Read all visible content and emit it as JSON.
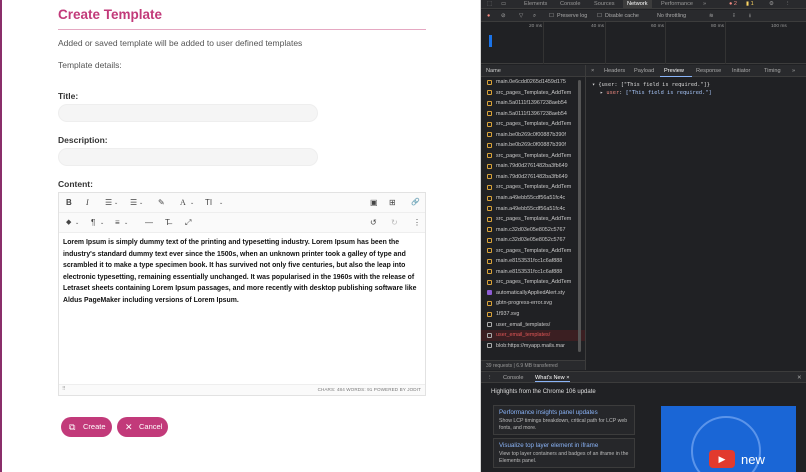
{
  "form": {
    "title": "Create Template",
    "subtitle": "Added or saved template will be added to user defined templates",
    "details_label": "Template details:",
    "title_label": "Title:",
    "description_label": "Description:",
    "content_label": "Content:",
    "content_text": "Lorem Ipsum is simply dummy text of the printing and typesetting industry. Lorem Ipsum has been the industry's standard dummy text ever since the 1500s, when an unknown printer took a galley of type and scrambled it to make a type specimen book. It has survived not only five centuries, but also the leap into electronic typesetting, remaining essentially unchanged. It was popularised in the 1960s with the release of Letraset sheets containing Lorem Ipsum passages, and more recently with desktop publishing software like Aldus PageMaker including versions of Lorem Ipsum.",
    "editor_status": "CHARS: 484  WORDS: 91  POWERED BY JODIT",
    "create_label": "Create",
    "cancel_label": "Cancel",
    "accent_color": "#c23a7a"
  },
  "toolbar": {
    "bold": "B",
    "italic": "I",
    "ul": "☰",
    "ol": "☰",
    "eraser": "✎",
    "font": "A",
    "size": "TI",
    "image": "▣",
    "table": "⊞",
    "link": "🔗",
    "color": "◆",
    "para": "¶",
    "align": "≡",
    "hr": "—",
    "clean": "T̶",
    "full": "⤢",
    "undo": "↺",
    "redo": "↻",
    "more": "⋮"
  },
  "devtools": {
    "top_tabs": [
      "Elements",
      "Console",
      "Sources",
      "Network",
      "Performance",
      "»"
    ],
    "badges": [
      "● 2",
      "▮ 1"
    ],
    "toolbar": [
      "Preserve log",
      "Disable cache",
      "No throttling"
    ],
    "ticks": [
      "20 ms",
      "40 ms",
      "60 ms",
      "80 ms",
      "100 ms"
    ],
    "name_header": "Name",
    "requests": [
      {
        "name": "main.0e6cdd0265d1459d175",
        "type": "js"
      },
      {
        "name": "src_pages_Templates_AddTem",
        "type": "js"
      },
      {
        "name": "main.5a0111f13967238aeb54",
        "type": "js"
      },
      {
        "name": "main.5a0111f13967238aeb54",
        "type": "js"
      },
      {
        "name": "src_pages_Templates_AddTem",
        "type": "js"
      },
      {
        "name": "main.be0b269c0f00887b390f",
        "type": "js"
      },
      {
        "name": "main.be0b269c0f00887b390f",
        "type": "js"
      },
      {
        "name": "src_pages_Templates_AddTem",
        "type": "js"
      },
      {
        "name": "main.79d0d2761482ba3fb649",
        "type": "js"
      },
      {
        "name": "main.79d0d2761482ba3fb649",
        "type": "js"
      },
      {
        "name": "src_pages_Templates_AddTem",
        "type": "js"
      },
      {
        "name": "main.a49ebb55cdf56a51fc4c",
        "type": "js"
      },
      {
        "name": "main.a49ebb55cdf56a51fc4c",
        "type": "js"
      },
      {
        "name": "src_pages_Templates_AddTem",
        "type": "js"
      },
      {
        "name": "main.c32d03e05e8052c5767",
        "type": "js"
      },
      {
        "name": "main.c32d03e05e8052c5767",
        "type": "js"
      },
      {
        "name": "src_pages_Templates_AddTem",
        "type": "js"
      },
      {
        "name": "main.e8153531fcc1c6af888",
        "type": "js"
      },
      {
        "name": "main.e8153531fcc1c6af888",
        "type": "js"
      },
      {
        "name": "src_pages_Templates_AddTem",
        "type": "js"
      },
      {
        "name": "automaticallyAppliedAlert.sty",
        "type": "img"
      },
      {
        "name": "gbtn-progress-error.svg",
        "type": "js"
      },
      {
        "name": "1f937.svg",
        "type": "js"
      },
      {
        "name": "user_email_templates/",
        "type": "doc"
      },
      {
        "name": "user_email_templates/",
        "type": "sel"
      },
      {
        "name": "blob:https://myapp.mails.mar",
        "type": "doc"
      }
    ],
    "footer": "39 requests  |  6.9 MB transferred",
    "panel_tabs": [
      "×",
      "Headers",
      "Payload",
      "Preview",
      "Response",
      "Initiator",
      "Timing",
      "»"
    ],
    "preview_line1": "▾ {user: [\"This field is required.\"]}",
    "preview_key": "user",
    "preview_val": "[\"This field is required.\"]",
    "drawer_tabs": [
      "⋮",
      "Console",
      "What's New ×"
    ],
    "highlights": "Highlights from the Chrome 106 update",
    "cards": [
      {
        "title": "Performance insights panel updates",
        "desc": "Show LCP timings breakdown, critical path for LCP web fonts, and more."
      },
      {
        "title": "Visualize top layer element in iframe",
        "desc": "View top layer containers and badges of an iframe in the Elements panel."
      }
    ],
    "new_text": "new"
  }
}
